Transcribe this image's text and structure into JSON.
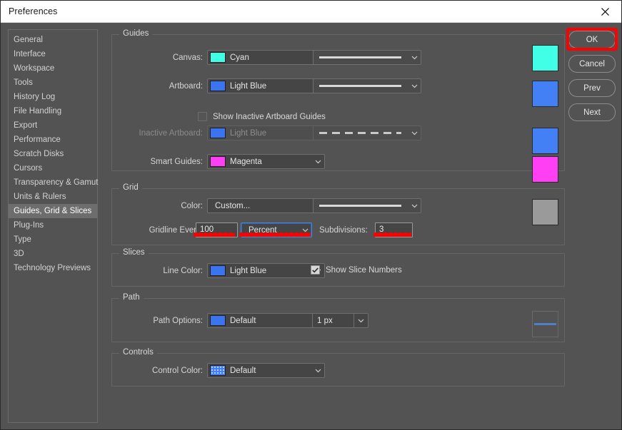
{
  "window": {
    "title": "Preferences",
    "close_icon": "close-icon"
  },
  "sidebar": {
    "items": [
      {
        "label": "General",
        "selected": false
      },
      {
        "label": "Interface",
        "selected": false
      },
      {
        "label": "Workspace",
        "selected": false
      },
      {
        "label": "Tools",
        "selected": false
      },
      {
        "label": "History Log",
        "selected": false
      },
      {
        "label": "File Handling",
        "selected": false
      },
      {
        "label": "Export",
        "selected": false
      },
      {
        "label": "Performance",
        "selected": false
      },
      {
        "label": "Scratch Disks",
        "selected": false
      },
      {
        "label": "Cursors",
        "selected": false
      },
      {
        "label": "Transparency & Gamut",
        "selected": false
      },
      {
        "label": "Units & Rulers",
        "selected": false
      },
      {
        "label": "Guides, Grid & Slices",
        "selected": true
      },
      {
        "label": "Plug-Ins",
        "selected": false
      },
      {
        "label": "Type",
        "selected": false
      },
      {
        "label": "3D",
        "selected": false
      },
      {
        "label": "Technology Previews",
        "selected": false
      }
    ]
  },
  "buttons": {
    "ok": "OK",
    "cancel": "Cancel",
    "prev": "Prev",
    "next": "Next"
  },
  "guides": {
    "title": "Guides",
    "canvas": {
      "label": "Canvas:",
      "color_name": "Cyan",
      "color_hex": "#41ffe6",
      "line_style": "solid",
      "swatch_hex": "#41ffe6"
    },
    "artboard": {
      "label": "Artboard:",
      "color_name": "Light Blue",
      "color_hex": "#3b74f0",
      "line_style": "solid",
      "swatch_hex": "#4480f5"
    },
    "show_inactive": {
      "label": "Show Inactive Artboard Guides",
      "checked": false
    },
    "inactive_artboard": {
      "label": "Inactive Artboard:",
      "color_name": "Light Blue",
      "color_hex": "#3b74f0",
      "line_style": "dashed",
      "swatch_hex": "#4480f5",
      "disabled": true
    },
    "smart_guides": {
      "label": "Smart Guides:",
      "color_name": "Magenta",
      "color_hex": "#ff3ff4",
      "swatch_hex": "#ff3ff4"
    }
  },
  "grid": {
    "title": "Grid",
    "color": {
      "label": "Color:",
      "value": "Custom...",
      "line_style": "solid",
      "swatch_hex": "#9a9a9a"
    },
    "gridline_every": {
      "label": "Gridline Every:",
      "value": "100",
      "unit": "Percent"
    },
    "subdivisions": {
      "label": "Subdivisions:",
      "value": "3"
    }
  },
  "slices": {
    "title": "Slices",
    "line_color": {
      "label": "Line Color:",
      "value": "Light Blue",
      "color_hex": "#3b74f0"
    },
    "show_slice_numbers": {
      "label": "Show Slice Numbers",
      "checked": true
    }
  },
  "path": {
    "title": "Path",
    "path_options": {
      "label": "Path Options:",
      "value": "Default",
      "color_hex": "#3b74f0"
    },
    "width": {
      "value": "1 px"
    }
  },
  "controls": {
    "title": "Controls",
    "control_color": {
      "label": "Control Color:",
      "value": "Default",
      "color_hex": "#4480f5"
    }
  },
  "annotations": {
    "highlight_color": "#fe0000",
    "ok_button_boxed": true,
    "underlined_fields": [
      "gridline_every_value",
      "gridline_every_unit",
      "subdivisions_value"
    ]
  }
}
